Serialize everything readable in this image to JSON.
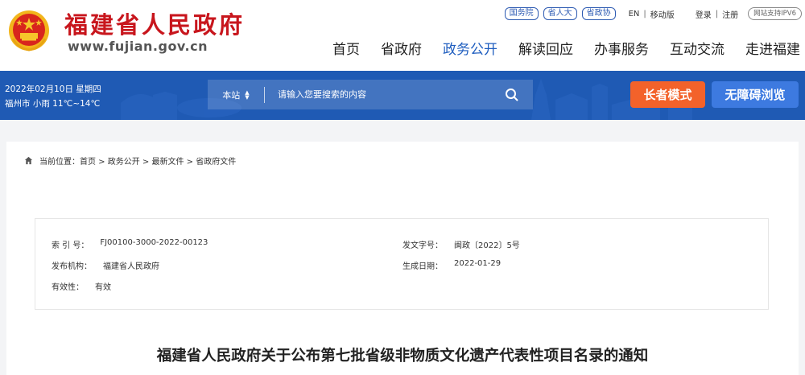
{
  "header": {
    "site_name_cn": "福建省人民政府",
    "site_name_en": "www.fujian.gov.cn",
    "gov_links": [
      "国务院",
      "省人大",
      "省政协"
    ],
    "lang_link": "EN",
    "mobile_link": "移动版",
    "login_link": "登录",
    "register_link": "注册",
    "ipv6_badge": "网站支持IPV6",
    "nav": [
      "首页",
      "省政府",
      "政务公开",
      "解读回应",
      "办事服务",
      "互动交流",
      "走进福建"
    ],
    "active_nav": "政务公开"
  },
  "infobar": {
    "date": "2022年02月10日 星期四",
    "weather": "福州市 小雨 11℃~14℃",
    "search_scope": "本站",
    "search_placeholder": "请输入您要搜索的内容",
    "elder_mode": "长者模式",
    "accessible": "无障碍浏览"
  },
  "breadcrumb": {
    "text": "当前位置：首页 > 政务公开 > 最新文件 > 省政府文件"
  },
  "meta": {
    "index_label": "索 引 号：",
    "index_value": "FJ00100-3000-2022-00123",
    "doc_no_label": "发文字号：",
    "doc_no_value": "闽政〔2022〕5号",
    "issuer_label": "发布机构：",
    "issuer_value": "福建省人民政府",
    "date_label": "生成日期：",
    "date_value": "2022-01-29",
    "validity_label": "有效性：",
    "validity_value": "有效"
  },
  "document": {
    "title": "福建省人民政府关于公布第七批省级非物质文化遗产代表性项目名录的通知"
  },
  "colors": {
    "brand_red": "#c8161d",
    "nav_active": "#1e5dbf",
    "bar_blue": "#1f5ab4",
    "elder_orange": "#f3622a",
    "access_blue": "#3d7ae0"
  }
}
